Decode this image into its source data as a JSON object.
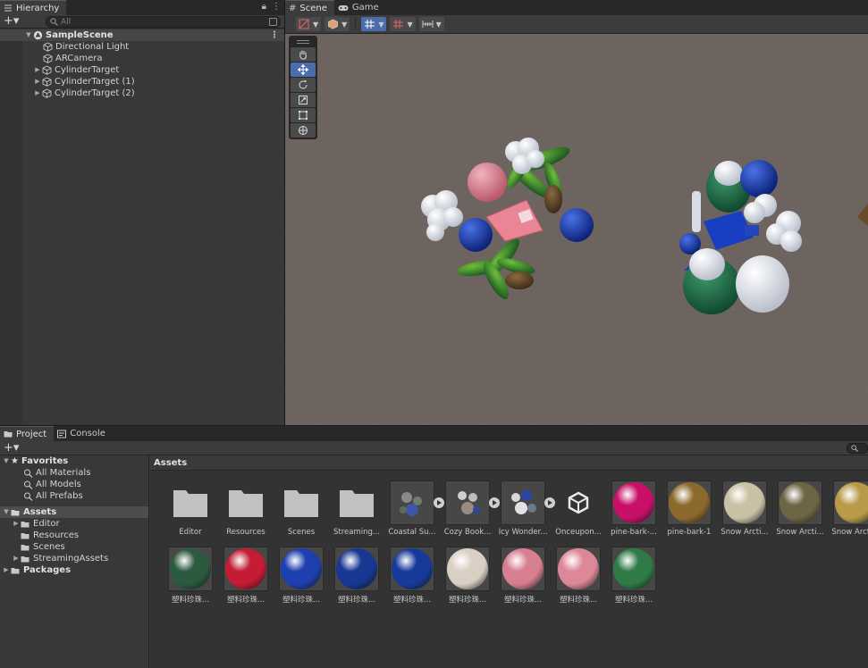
{
  "hierarchy": {
    "tab": "Hierarchy",
    "search_placeholder": "All",
    "scene_name": "SampleScene",
    "items": [
      {
        "label": "Directional Light",
        "expandable": false
      },
      {
        "label": "ARCamera",
        "expandable": false
      },
      {
        "label": "CylinderTarget",
        "expandable": true
      },
      {
        "label": "CylinderTarget (1)",
        "expandable": true
      },
      {
        "label": "CylinderTarget (2)",
        "expandable": true
      }
    ]
  },
  "scene": {
    "tabs": [
      "Scene",
      "Game"
    ],
    "colors": {
      "viewport": "#6d6460",
      "grid": "#7a716d",
      "accent": "#4b6dab"
    }
  },
  "project": {
    "tabs": [
      "Project",
      "Console"
    ],
    "favorites": {
      "label": "Favorites",
      "items": [
        "All Materials",
        "All Models",
        "All Prefabs"
      ]
    },
    "assets_root": "Assets",
    "asset_folders": [
      "Editor",
      "Resources",
      "Scenes",
      "StreamingAssets"
    ],
    "packages": "Packages",
    "breadcrumb": "Assets",
    "grid_row1": [
      {
        "label": "Editor",
        "kind": "folder"
      },
      {
        "label": "Resources",
        "kind": "folder"
      },
      {
        "label": "Scenes",
        "kind": "folder"
      },
      {
        "label": "Streaming...",
        "kind": "folder"
      },
      {
        "label": "Coastal Su...",
        "kind": "prefab"
      },
      {
        "label": "Cozy Book...",
        "kind": "prefab"
      },
      {
        "label": "Icy Wonder...",
        "kind": "prefab"
      },
      {
        "label": "Onceupon...",
        "kind": "unity"
      },
      {
        "label": "pine-bark-...",
        "kind": "material",
        "color": "#c8106a"
      },
      {
        "label": "pine-bark-1",
        "kind": "material",
        "color": "#8c6a2e"
      },
      {
        "label": "Snow Arcti...",
        "kind": "material",
        "color": "#c9c0a5"
      },
      {
        "label": "Snow Arcti...",
        "kind": "material",
        "color": "#6e6544"
      },
      {
        "label": "Snow Arcti...",
        "kind": "material",
        "color": "#b89a48"
      }
    ],
    "grid_row2": [
      {
        "label": "塑料珍珠...",
        "kind": "material",
        "color": "#2c5a3f"
      },
      {
        "label": "塑料珍珠...",
        "kind": "material",
        "color": "#c41c34"
      },
      {
        "label": "塑料珍珠...",
        "kind": "material",
        "color": "#1e3fae"
      },
      {
        "label": "塑料珍珠...",
        "kind": "material",
        "color": "#173792"
      },
      {
        "label": "塑料珍珠...",
        "kind": "material",
        "color": "#173a9a"
      },
      {
        "label": "塑料珍珠...",
        "kind": "material",
        "color": "#d9cfc4"
      },
      {
        "label": "塑料珍珠...",
        "kind": "material",
        "color": "#d77e90"
      },
      {
        "label": "塑料珍珠...",
        "kind": "material",
        "color": "#dd8898"
      },
      {
        "label": "塑料珍珠...",
        "kind": "material",
        "color": "#2f7a45"
      }
    ]
  }
}
